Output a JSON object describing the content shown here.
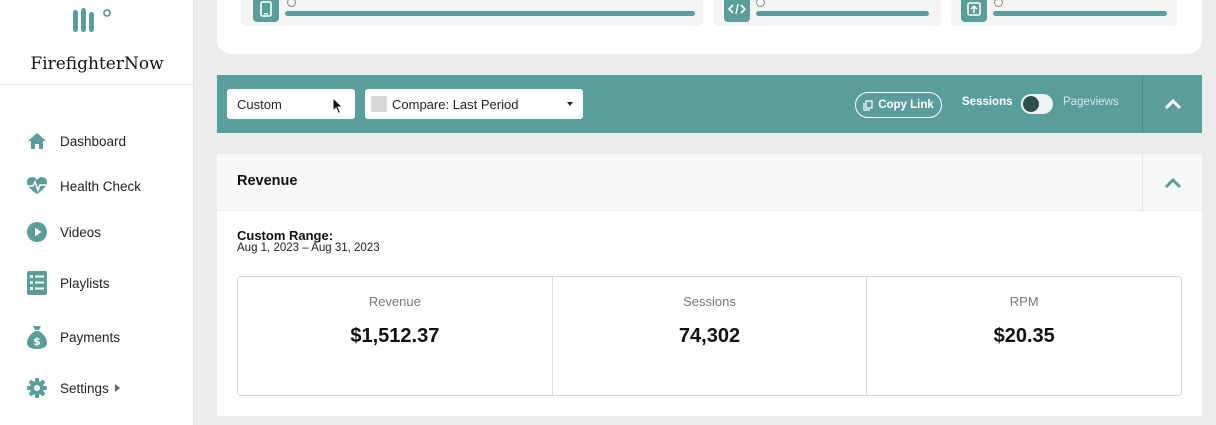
{
  "sidebar": {
    "brand": "FirefighterNow",
    "logo_icon": "brand-logo",
    "items": [
      {
        "label": "Dashboard",
        "icon": "home-icon"
      },
      {
        "label": "Health Check",
        "icon": "heartbeat-icon"
      },
      {
        "label": "Videos",
        "icon": "play-circle-icon"
      },
      {
        "label": "Playlists",
        "icon": "checklist-icon"
      },
      {
        "label": "Payments",
        "icon": "money-bag-icon"
      },
      {
        "label": "Settings",
        "icon": "gear-icon",
        "has_submenu": true
      }
    ]
  },
  "top_card": {
    "cards": [
      {
        "icon": "tablet-icon"
      },
      {
        "icon": "code-icon"
      },
      {
        "icon": "upload-icon"
      }
    ]
  },
  "toolbar": {
    "date_range": "Custom",
    "compare": "Compare: Last Period",
    "copy_link": "Copy Link",
    "toggle_left": "Sessions",
    "toggle_right": "Pageviews",
    "collapse_icon": "chevron-up-icon"
  },
  "revenue": {
    "title": "Revenue",
    "range_label": "Custom Range:",
    "range_dates": "Aug 1, 2023 – Aug 31, 2023",
    "metrics": [
      {
        "label": "Revenue",
        "value": "$1,512.37"
      },
      {
        "label": "Sessions",
        "value": "74,302"
      },
      {
        "label": "RPM",
        "value": "$20.35"
      }
    ]
  },
  "colors": {
    "accent": "#5a9e9b",
    "sidebar_bg": "#ffffff",
    "page_bg": "#ececec"
  }
}
